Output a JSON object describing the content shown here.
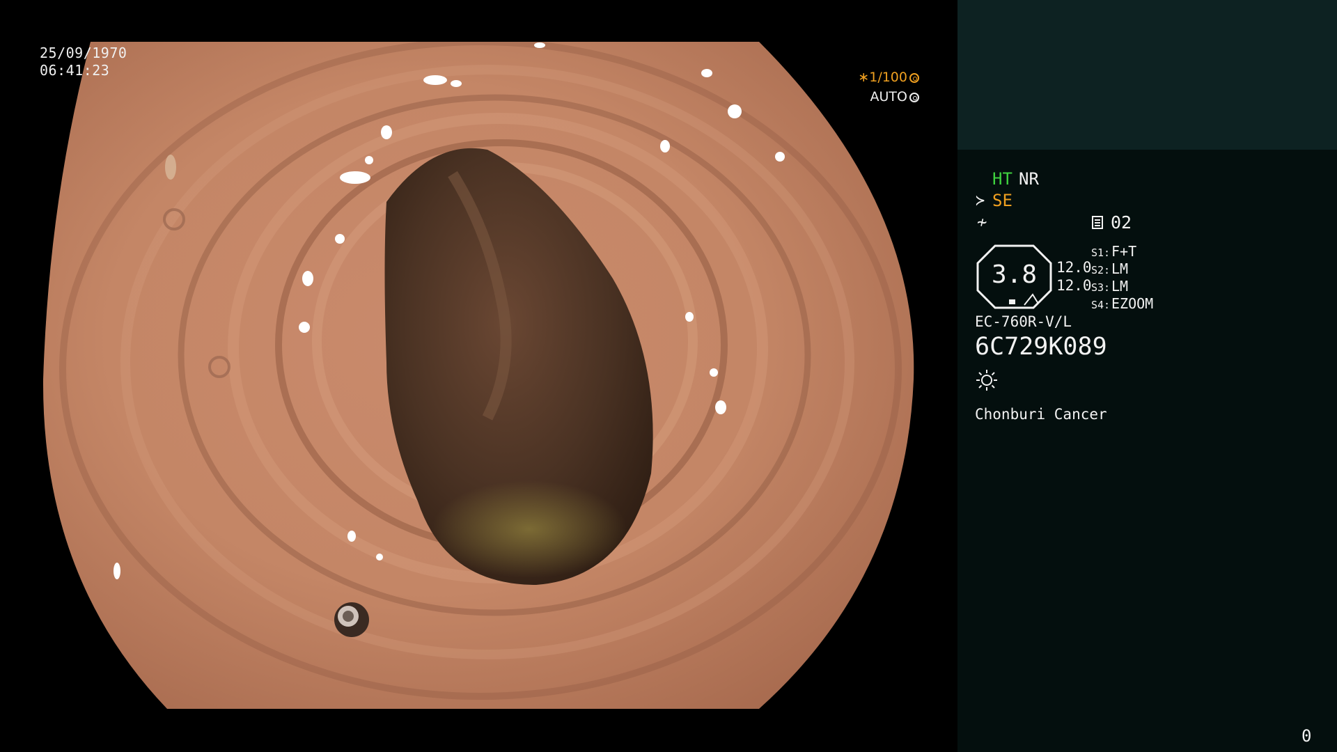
{
  "overlay": {
    "date": "25/09/1970",
    "time": "06:41:23",
    "shutter": "∗1/100",
    "iris_mode": "AUTO"
  },
  "panel": {
    "enhance_ht": "HT",
    "enhance_nr": "NR",
    "structure_mode": "SE",
    "preset_number": "02",
    "tip_value": "3.8",
    "values": [
      "12.0",
      "12.0"
    ],
    "switches": [
      {
        "label": "S1:",
        "value": "F+T"
      },
      {
        "label": "S2:",
        "value": "LM"
      },
      {
        "label": "S3:",
        "value": "LM"
      },
      {
        "label": "S4:",
        "value": "EZOOM"
      }
    ],
    "scope_model": "EC-760R-V/L",
    "scope_serial": "6C729K089",
    "hospital": "Chonburi Cancer",
    "counter": "0"
  },
  "colors": {
    "panel_bg": "#040f0e",
    "panel_top_bg": "#0d2222",
    "ht_green": "#3fd23f",
    "se_orange": "#f0a020",
    "shutter_orange": "#f0a020"
  },
  "icons": [
    "shutter-ring-icon",
    "iris-ring-icon",
    "structure-enhance-icon",
    "noise-reduction-icon",
    "preset-doc-icon",
    "scope-tip-octagon-icon",
    "light-source-icon"
  ]
}
